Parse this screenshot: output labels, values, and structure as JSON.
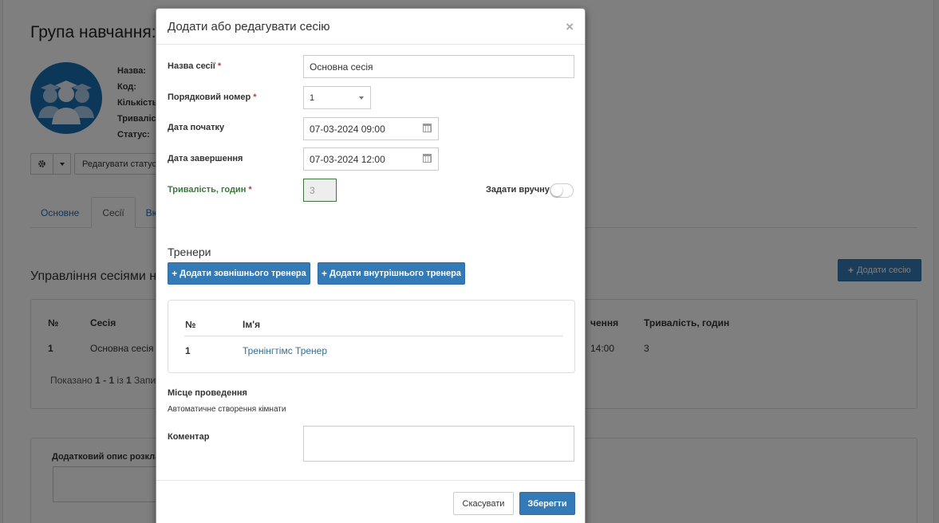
{
  "background": {
    "page_title": "Група навчання:",
    "info_labels": [
      "Назва:",
      "Код:",
      "Кількість",
      "Тривалість",
      "Статус:"
    ],
    "toolbar": {
      "edit_status": "Редагувати статус"
    },
    "tabs": [
      "Основне",
      "Сесії",
      "Вю"
    ],
    "section_title": "Управління сесіями на",
    "add_session": "Додати сесію",
    "table_headers": [
      "№",
      "Сесія",
      "чення",
      "Тривалість, годин"
    ],
    "table_row": [
      "1",
      "Основна сесія",
      "14:00",
      "3"
    ],
    "footer": {
      "prefix": "Показано ",
      "range": "1 - 1",
      "mid": " із ",
      "total": "1",
      "suffix": " Запи"
    },
    "desc_label": "Додатковий опис розкла"
  },
  "modal": {
    "title": "Додати або редагувати сесію",
    "close": "×",
    "fields": {
      "session_name": {
        "label": "Назва сесії",
        "value": "Основна сесія"
      },
      "order_number": {
        "label": "Порядковий номер",
        "value": "1"
      },
      "start_date": {
        "label": "Дата початку",
        "value": "07-03-2024 09:00"
      },
      "end_date": {
        "label": "Дата завершення",
        "value": "07-03-2024 12:00"
      },
      "duration": {
        "label": "Тривалість, годин",
        "value": "3"
      },
      "manual": {
        "label": "Задати вручну"
      }
    },
    "required_mark": "*",
    "trainers": {
      "heading": "Тренери",
      "add_external": "Додати зовнішнього тренера",
      "add_internal": "Додати внутрішнього тренера",
      "headers": [
        "№",
        "Ім'я"
      ],
      "rows": [
        {
          "num": "1",
          "name": "Тренінгтімс Тренер"
        }
      ]
    },
    "location": {
      "label": "Місце проведення",
      "value": "Автоматичне створення кімнати"
    },
    "comment": {
      "label": "Коментар"
    },
    "buttons": {
      "cancel": "Скасувати",
      "save": "Зберегти"
    }
  },
  "colors": {
    "primary": "#337ab7",
    "label_green": "#3c763d",
    "required_red": "#a94442"
  }
}
